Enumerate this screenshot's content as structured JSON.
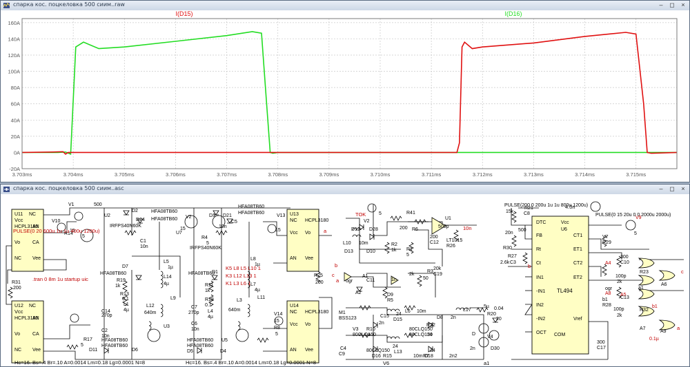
{
  "waveform_window": {
    "title": "спарка кос. поцкеловка 500 сиим..raw",
    "trace_labels": [
      "I(D15)",
      "I(D16)"
    ],
    "trace_colors": {
      "I(D15)": "#e01010",
      "I(D16)": "#22dd22"
    }
  },
  "schematic_window": {
    "title": "спарка кос. поцкеловка 500 сиим..asc"
  },
  "chart_data": {
    "type": "line",
    "xlabel": "",
    "ylabel": "",
    "x_ticks": [
      "3.703ms",
      "3.704ms",
      "3.705ms",
      "3.706ms",
      "3.707ms",
      "3.708ms",
      "3.709ms",
      "3.710ms",
      "3.711ms",
      "3.712ms",
      "3.713ms",
      "3.714ms",
      "3.715ms"
    ],
    "y_ticks": [
      "-20A",
      "0A",
      "20A",
      "40A",
      "60A",
      "80A",
      "100A",
      "120A",
      "140A",
      "160A"
    ],
    "xlim": [
      3.703,
      3.7158
    ],
    "ylim": [
      -20,
      165
    ],
    "grid": true,
    "series": [
      {
        "name": "I(D16)",
        "color": "#22dd22",
        "x": [
          3.703,
          3.7037,
          3.70385,
          3.70395,
          3.70405,
          3.7042,
          3.7045,
          3.705,
          3.706,
          3.707,
          3.7075,
          3.70768,
          3.70778,
          3.70785,
          3.7079,
          3.708,
          3.709,
          3.71,
          3.711,
          3.7115,
          3.712,
          3.713,
          3.714,
          3.715,
          3.7158
        ],
        "y": [
          0,
          0,
          0.5,
          -2,
          130,
          136,
          128,
          130,
          137,
          144,
          149,
          147,
          60,
          0,
          -1,
          0,
          0,
          0,
          0,
          0,
          0,
          0,
          0,
          0,
          0
        ]
      },
      {
        "name": "I(D15)",
        "color": "#e01010",
        "x": [
          3.703,
          3.7036,
          3.7038,
          3.70385,
          3.7039,
          3.704,
          3.705,
          3.707,
          3.709,
          3.7113,
          3.7115,
          3.71155,
          3.7116,
          3.71165,
          3.7118,
          3.712,
          3.713,
          3.714,
          3.7148,
          3.715,
          3.71515,
          3.71522,
          3.7153,
          3.7158
        ],
        "y": [
          0,
          0.5,
          1,
          -2,
          0,
          0,
          0,
          0,
          0,
          0,
          0,
          12,
          130,
          136,
          128,
          130,
          135,
          143,
          148,
          146,
          60,
          0,
          -1,
          0
        ]
      }
    ]
  },
  "schematic": {
    "components": {
      "u11": [
        "U11",
        "NC",
        "Vcc",
        "HCPL3180",
        "AN",
        "Vo",
        "CA",
        "NC",
        "Vee"
      ],
      "u12": [
        "U12",
        "NC",
        "Vcc",
        "HCPL3180",
        "AN",
        "Vo",
        "CA",
        "NC",
        "Vee"
      ],
      "u13": [
        "U13",
        "NC",
        "HCPL3180",
        "Vcc",
        "Vo",
        "AN",
        "Vee",
        "NC"
      ],
      "u14": [
        "U14",
        "NC",
        "HCPL3180",
        "Vcc",
        "Vo",
        "AN",
        "Vee",
        "NC"
      ],
      "u6": [
        "DTC",
        "Vcc",
        "U6",
        "FB",
        "CT1",
        "Rt",
        "ET1",
        "Ct",
        "CT2",
        "IN1",
        "ET2",
        "-IN1",
        "TL494",
        "IN2",
        "-IN2",
        "Vref",
        "OCT",
        "COM"
      ]
    },
    "labels": [
      "V1",
      "500",
      "U2",
      "V10",
      "15",
      "R14",
      "5",
      "IRFPS40N60K",
      "D2",
      "D24",
      "HFA08TB60",
      "HFA08TB60",
      "C1",
      "10n",
      "L5",
      "1µ",
      "D7",
      "HFA08TB60",
      "R19",
      "1k",
      "R13",
      "0.1",
      "L1",
      "4µ",
      "L14",
      "4µ",
      "L9",
      "L12",
      "640m",
      "C14",
      "270p",
      "C2",
      "10n",
      "D11",
      "HFA08TB60",
      "HFA08TB60",
      "D6",
      "U3",
      "R17",
      "5",
      "R31",
      "200",
      "V2",
      "15",
      "U7",
      "R4",
      "5",
      "IRFPS40N60K",
      "D3",
      "D21",
      "HFA08TB60",
      "HFA08TB60",
      "C5",
      "10n",
      "V13",
      "15",
      "D1",
      "HFA08TB60",
      "R11",
      "1k",
      "R18",
      "0.1",
      "L4",
      "4µ",
      "C7",
      "270p",
      "C6",
      "10n",
      "U5",
      "L8",
      "1µ",
      "L7",
      "4µ",
      "L3",
      "640m",
      "L11",
      "R8",
      "5",
      "V14",
      "15",
      "R25",
      "200",
      "D5",
      "D4",
      "HFA08TB60",
      "HFA08TB60",
      "K5 L8 L5 L10 1",
      "K3 L12 L13 1",
      "K1 L3 L6 1",
      ".tran 0 8m 1u startup uic",
      "Hc=16. Bs=.4 Br=.10 A=0.0014 Lm=0.18 Lg=0.0001 N=8",
      "Hc=16. Bs=.4 Br=.10 A=0.0014 Lm=0.18 Lg=0.0001 N=8",
      "TOK",
      "V2",
      "5",
      "D12",
      "D28",
      "L10",
      "10m",
      "D13",
      "D10",
      "R2",
      "1k",
      "R1",
      "5",
      "R41",
      "200",
      "R6",
      "200",
      "C12",
      "500p",
      "U1",
      "LT1015",
      "R26",
      "20k",
      "C19",
      "10n",
      "ogr",
      "A1",
      "C11",
      "1n",
      "A2",
      "D9",
      "R5",
      "2k",
      "R3",
      "50",
      "M1",
      "BSS123",
      "C15",
      "2n",
      "R10",
      "24",
      "D15",
      "L6",
      "10m",
      "R22",
      "24",
      "D8",
      "2n",
      "L17",
      "5µ",
      "R20",
      "0.04",
      "D",
      "V4",
      "20",
      "D30",
      "V3",
      "80CLQ150",
      "80CLQ150",
      "80CLQ150",
      "80CLQ150",
      "D16",
      "R15",
      "24",
      "L13",
      "10m",
      "R7",
      "24",
      "D18",
      "2n2",
      "C4",
      "C9",
      "2n",
      "V6",
      "PULSE(200 0 200u 1u 1u 800u 1200u)",
      "15k",
      "R21",
      "C8",
      "20n",
      "500",
      "R30",
      "R27",
      "2.6k",
      "C3",
      "4.0n",
      "PULSE(0 15 20u 0 0 2000u 2000u)",
      "V9",
      "5",
      "V7",
      "R29",
      "300",
      "C10",
      "100p",
      "2k",
      "R23",
      "A4",
      "a1",
      "A6",
      "A5",
      "ogr",
      "C13",
      "100p",
      "2k",
      "R32",
      "A7",
      "A9",
      "A8",
      "b1",
      "R28",
      "300",
      "C17",
      "0.1µ",
      "b1",
      "a1",
      "PULSE(0 20 600u 1u 1u 400u 1200u)",
      "a",
      "b",
      "c",
      "a",
      "b",
      "c",
      "a",
      "b"
    ]
  }
}
